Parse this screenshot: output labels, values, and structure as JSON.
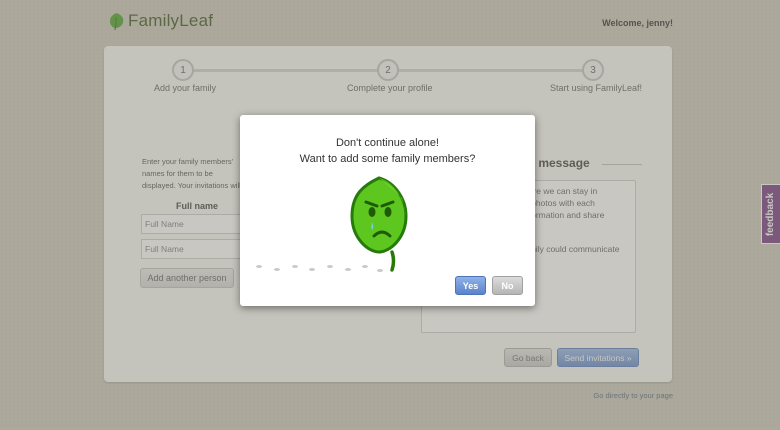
{
  "header": {
    "logo_text": "FamilyLeaf",
    "welcome": "Welcome, jenny!"
  },
  "steps": [
    {
      "number": "1",
      "label": "Add your family"
    },
    {
      "number": "2",
      "label": "Complete your profile"
    },
    {
      "number": "3",
      "label": "Start using FamilyLeaf!"
    }
  ],
  "form": {
    "intro_text": "Enter your family members' names for them to be displayed. Your invitations will be sent when you click \"Send invitations\" below.",
    "fullname_heading": "Full name",
    "name_placeholder": "Full Name",
    "add_person_label": "Add another person"
  },
  "message": {
    "heading": "ur message",
    "lines": [
      "here we can stay in",
      "e photos with each",
      "nformation and share",
      "amily could communicate",
      "n!"
    ]
  },
  "actions": {
    "go_back": "Go back",
    "send_invitations": "Send invitations »",
    "go_direct": "Go directly to your page"
  },
  "feedback_label": "feedback",
  "modal": {
    "line1": "Don't continue alone!",
    "line2": "Want to add some family members?",
    "yes_label": "Yes",
    "no_label": "No",
    "mascot_icon": "sad-leaf-icon"
  },
  "colors": {
    "brand_green": "#4cb01e",
    "primary_blue": "#5b83cc",
    "feedback_purple": "#6b2d7e"
  }
}
